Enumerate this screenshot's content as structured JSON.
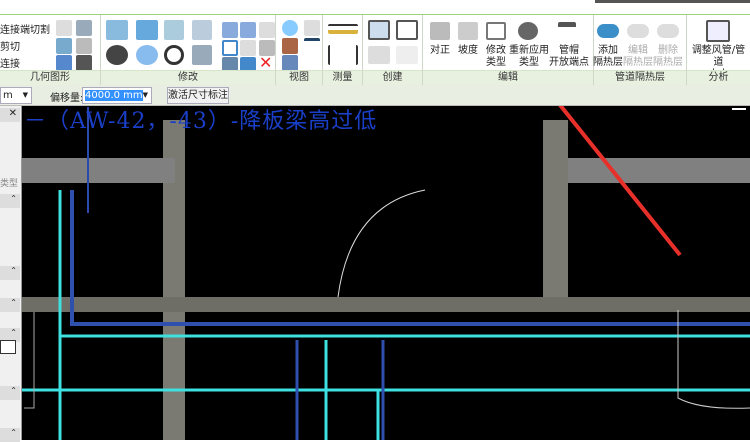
{
  "ribbon": {
    "geometry": {
      "items": [
        "连接端切割",
        "剪切",
        "连接"
      ],
      "label": "几何图形"
    },
    "modify": {
      "label": "修改"
    },
    "view": {
      "label": "视图"
    },
    "measure": {
      "label": "测量"
    },
    "create": {
      "label": "创建"
    },
    "edit": {
      "label": "编辑",
      "buttons": [
        {
          "l1": "对正",
          "l2": ""
        },
        {
          "l1": "坡度",
          "l2": ""
        },
        {
          "l1": "修改",
          "l2": "类型"
        },
        {
          "l1": "重新应用",
          "l2": "类型"
        },
        {
          "l1": "管帽",
          "l2": "开放端点"
        }
      ]
    },
    "insulation": {
      "label": "管道隔热层",
      "buttons": [
        {
          "l1": "添加",
          "l2": "隔热层"
        },
        {
          "l1": "编辑",
          "l2": "隔热层"
        },
        {
          "l1": "删除",
          "l2": "隔热层"
        }
      ]
    },
    "analysis": {
      "label": "分析",
      "button": {
        "l1": "调整风管/管道",
        "l2": "大小"
      }
    }
  },
  "options": {
    "unit_dropdown": "m",
    "offset_label": "偏移量:",
    "offset_value": "4000.0 mm",
    "activate_dim_button": "激活尺寸标注"
  },
  "properties": {
    "type_label": "类型"
  },
  "canvas": {
    "annotation": "－（AW-42，-43）-降板梁高过低"
  },
  "colors": {
    "accent_green": "#9fd37a",
    "annotation_blue": "#1a3fc8",
    "pipe_cyan": "#3ee0e0",
    "pipe_blue": "#3050b0",
    "arrow_red": "#e8302a"
  }
}
